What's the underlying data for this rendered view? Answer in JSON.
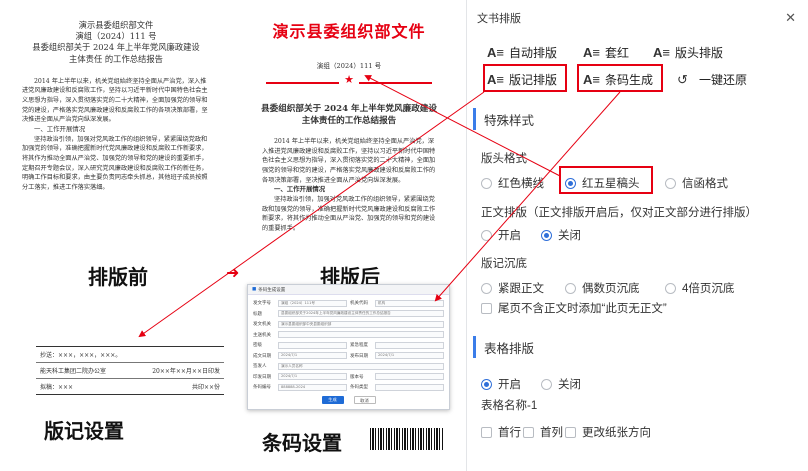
{
  "doc_before": {
    "line1": "演示县委组织部文件",
    "line2": "演组（2024）111 号",
    "title1": "县委组织部关于 2024 年上半年党风廉政建设",
    "title2": "主体责任 的工作总结报告",
    "body1": "2014 年上半年以来，机关党组始终坚持全面从严治党，深入推进党风廉政建设和反腐败工作，坚持以习近平新时代中国特色社会主义思想为指导，深入贯彻落实党的二十大精神，全面加强党的领导和党的建设，严格落实党风廉政建设和反腐败工作的各项决策部署，坚决推进全面从严治党向纵深发展。",
    "sec1": "一、工作开展情况",
    "body2": "坚持政治引领，加强对党风政工作的组织领导，紧紧围绕党政和加强党的领导，准确把握新时代党风廉政建设和反腐败工作新要求，将其作为推动全面从严治党、加强党的领导和党的建设的重要抓手，定期召开专题会议，深入研究党风廉政建设和反腐败工作的新任务，明确工作目标和要求，由主要负责同志牵头抓总，其他班子成员按照分工落实，推进工作落实落细。"
  },
  "doc_after": {
    "red_title": "演示县委组织部文件",
    "number": "演组（2024）111 号",
    "title": "县委组织部关于 2024 年上半年党风廉政建设主体责任的工作总结报告",
    "body1": "2014 年上半年以来，机关党组始终坚持全面从严治党，深入推进党风廉政建设和反腐败工作，坚持以习近平新时代中国特色社会主义思想为指导，深入贯彻落实党的二十大精神，全面加强党的领导和党的建设，严格落实党风廉政建设和反腐败工作的各项决策部署，坚决推进全面从严治党向纵深发展。",
    "sec1": "一、工作开展情况",
    "body2": "坚持政治引领，加强对党风政工作的组织领导，紧紧围绕党政和加强党的领导，准确把握新时代党风廉政建设和反腐败工作新要求，将其作为推动全面从严治党、加强党的领导和党的建设的重要抓手。"
  },
  "labels": {
    "before": "排版前",
    "after": "排版后",
    "colophon": "版记设置",
    "barcode": "条码设置"
  },
  "colophon": {
    "cc": "抄送：×××，×××，×××。",
    "issuer": "能天科工集团二院办公室",
    "date": "20××年××月××日印发",
    "sign": "拟稿：×××",
    "copies": "共印××份"
  },
  "dialog": {
    "title": "条码生成设置",
    "rows": [
      {
        "l1": "发文字号",
        "v1": "演组（2024）111号",
        "l2": "机关代码",
        "v2": "机构"
      },
      {
        "l1": "标题",
        "v1": "县委组织部关于2024年上半年党风廉政建设主体责任的工作总结报告",
        "l2": "",
        "v2": ""
      },
      {
        "l1": "发文机关",
        "v1": "演示县委组织部中央县委组织部",
        "l2": "",
        "v2": ""
      },
      {
        "l1": "主送机关",
        "v1": "",
        "l2": "",
        "v2": ""
      },
      {
        "l1": "密级",
        "v1": "",
        "l2": "紧急程度",
        "v2": ""
      },
      {
        "l1": "成文日期",
        "v1": "2024/7/1",
        "l2": "发布日期",
        "v2": "2024/7/1"
      },
      {
        "l1": "签发人",
        "v1": "演示人员名称",
        "l2": "",
        "v2": ""
      },
      {
        "l1": "印发日期",
        "v1": "2024/7/1",
        "l2": "版本号",
        "v2": ""
      },
      {
        "l1": "条码编号",
        "v1": "888888-2024",
        "l2": "条码类型",
        "v2": ""
      }
    ],
    "ok": "生成",
    "cancel": "取消"
  },
  "panel": {
    "title": "文书排版",
    "close_icon": "close-icon",
    "tools": {
      "auto": "自动排版",
      "redhead": "套红",
      "header": "版头排版",
      "colophon": "版记排版",
      "barcode": "条码生成",
      "restore": "一键还原"
    },
    "special_title": "特殊样式",
    "header_format": "版头格式",
    "header_options": [
      "红色横线",
      "红五星稿头",
      "信函格式"
    ],
    "body_layout": "正文排版（正文排版开启后，仅对正文部分进行排版）",
    "on": "开启",
    "off": "关闭",
    "colophon_sink": "版记沉底",
    "sink_options": [
      "紧跟正文",
      "偶数页沉底",
      "4倍页沉底"
    ],
    "last_page_note": "尾页不含正文时添加“此页无正文”",
    "table_title": "表格排版",
    "table_name": "表格名称-1",
    "table_checks": [
      "首行",
      "首列",
      "更改纸张方向"
    ]
  },
  "colors": {
    "accent_red": "#e60012",
    "accent_blue": "#2f6fd9"
  }
}
